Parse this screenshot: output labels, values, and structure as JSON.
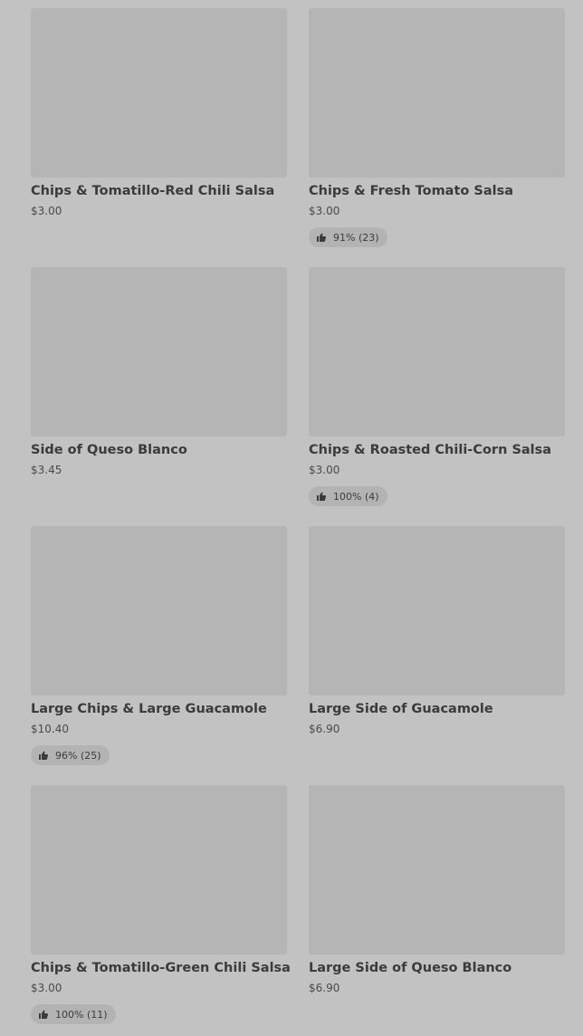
{
  "items": [
    {
      "name": "Chips & Tomatillo-Red Chili Salsa",
      "price": "$3.00",
      "rating": null
    },
    {
      "name": "Chips & Fresh Tomato Salsa",
      "price": "$3.00",
      "rating": "91% (23)"
    },
    {
      "name": "Side of Queso Blanco",
      "price": "$3.45",
      "rating": null
    },
    {
      "name": "Chips & Roasted Chili-Corn Salsa",
      "price": "$3.00",
      "rating": "100% (4)"
    },
    {
      "name": "Large Chips & Large Guacamole",
      "price": "$10.40",
      "rating": "96% (25)"
    },
    {
      "name": "Large Side of Guacamole",
      "price": "$6.90",
      "rating": null
    },
    {
      "name": "Chips & Tomatillo-Green Chili Salsa",
      "price": "$3.00",
      "rating": "100% (11)"
    },
    {
      "name": "Large Side of Queso Blanco",
      "price": "$6.90",
      "rating": null
    }
  ],
  "icons": {
    "rating": "thumbs-up-icon"
  },
  "colors": {
    "background": "#c2c2c2",
    "image_placeholder": "#b5b5b5",
    "badge": "#b3b3b3",
    "text": "#3b3b3b"
  }
}
